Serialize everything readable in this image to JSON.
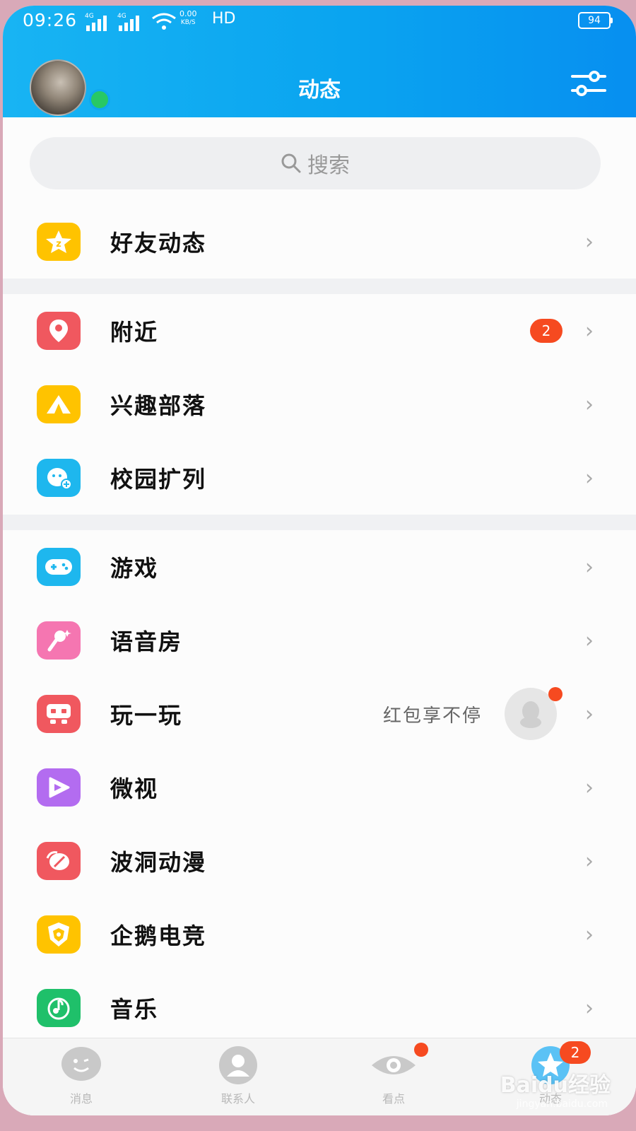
{
  "status_bar": {
    "time": "09:26",
    "network": "4G",
    "net_speed_value": "0.00",
    "net_speed_unit": "KB/S",
    "hd": "HD",
    "battery": "94"
  },
  "header": {
    "title": "动态",
    "online_color": "#28c865",
    "gradient": [
      "#18b4f3",
      "#078ff0"
    ]
  },
  "search": {
    "placeholder": "搜索"
  },
  "sections": [
    {
      "items": [
        {
          "label": "好友动态",
          "icon": "friend-feed-icon",
          "color": "#ffc300"
        }
      ]
    },
    {
      "items": [
        {
          "label": "附近",
          "icon": "location-pin-icon",
          "color": "#f0585f",
          "badge": "2"
        },
        {
          "label": "兴趣部落",
          "icon": "tent-icon",
          "color": "#ffc300"
        },
        {
          "label": "校园扩列",
          "icon": "campus-face-icon",
          "color": "#1eb7ee"
        }
      ]
    },
    {
      "items": [
        {
          "label": "游戏",
          "icon": "gamepad-icon",
          "color": "#1eb7ee"
        },
        {
          "label": "语音房",
          "icon": "microphone-icon",
          "color": "#f576b1"
        },
        {
          "label": "玩一玩",
          "icon": "mini-game-icon",
          "color": "#f0585f",
          "promo": "红包享不停"
        },
        {
          "label": "微视",
          "icon": "weishi-play-icon",
          "color": "#b36cf0"
        },
        {
          "label": "波洞动漫",
          "icon": "bodong-anime-icon",
          "color": "#f0585f"
        },
        {
          "label": "企鹅电竞",
          "icon": "esports-shield-icon",
          "color": "#ffc300"
        },
        {
          "label": "音乐",
          "icon": "music-note-icon",
          "color": "#1fc06a"
        }
      ]
    }
  ],
  "tabbar": {
    "tabs": [
      {
        "label": "消息",
        "icon": "message-icon"
      },
      {
        "label": "联系人",
        "icon": "contacts-icon"
      },
      {
        "label": "看点",
        "icon": "eye-icon"
      },
      {
        "label": "动态",
        "icon": "star-icon",
        "badge": "2"
      }
    ],
    "watermark": "Baidu经验",
    "watermark_sub": "jingyan.baidu.com"
  }
}
